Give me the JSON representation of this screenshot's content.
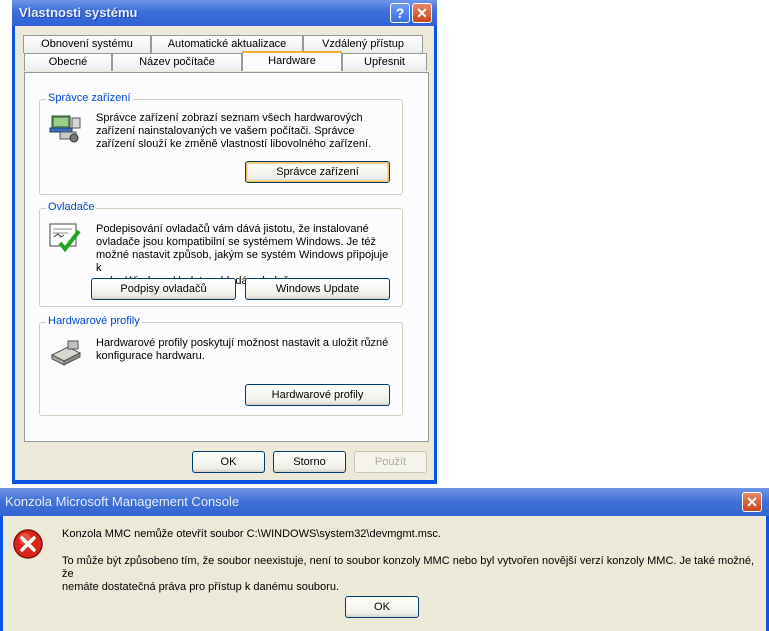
{
  "system_properties": {
    "title": "Vlastnosti systému",
    "help_glyph": "?",
    "close_glyph": "✕",
    "tabs_row_back": [
      {
        "label": "Obnovení systému"
      },
      {
        "label": "Automatické aktualizace"
      },
      {
        "label": "Vzdálený přístup"
      }
    ],
    "tabs_row_front": [
      {
        "label": "Obecné"
      },
      {
        "label": "Název počítače"
      },
      {
        "label": "Hardware",
        "active": true
      },
      {
        "label": "Upřesnit"
      }
    ],
    "device_manager": {
      "legend": "Správce zařízení",
      "text_lines": [
        "Správce zařízení zobrazí seznam všech hardwarových",
        "zařízení nainstalovaných ve vašem počítači. Správce",
        "zařízení slouží ke změně vlastností libovolného zařízení."
      ],
      "button": "Správce zařízení",
      "icon": "device-manager-icon"
    },
    "drivers": {
      "legend": "Ovladače",
      "text_lines": [
        "Podepisování ovladačů vám dává jistotu, že instalované",
        "ovladače jsou kompatibilní se systémem Windows. Je též",
        "možné nastavit způsob, jakým se systém Windows připojuje k",
        "webu Windows Update a hledá ovladače."
      ],
      "button_signing": "Podpisy ovladačů",
      "button_update": "Windows Update",
      "icon": "driver-signing-icon"
    },
    "hardware_profiles": {
      "legend": "Hardwarové profily",
      "text_lines": [
        "Hardwarové profily poskytují možnost nastavit a uložit různé",
        "konfigurace hardwaru."
      ],
      "button": "Hardwarové profily",
      "icon": "hardware-profiles-icon"
    },
    "footer": {
      "ok": "OK",
      "cancel": "Storno",
      "apply": "Použít"
    }
  },
  "mmc_error": {
    "title": "Konzola Microsoft Management Console",
    "close_glyph": "✕",
    "icon": "error-icon",
    "line1": "Konzola MMC nemůže otevřít soubor C:\\WINDOWS\\system32\\devmgmt.msc.",
    "line2a": "To může být způsobeno tím, že soubor neexistuje, není to soubor konzoly MMC nebo byl vytvořen novější verzí konzoly MMC. Je také možné, že",
    "line2b": "nemáte dostatečná práva pro přístup k danému souboru.",
    "ok": "OK"
  },
  "colors": {
    "title_bar": "#2f63d6",
    "dialog_bg": "#ece9d8",
    "group_legend": "#0046d5",
    "active_tab_accent": "#f7b236",
    "close_button": "#c8441c"
  }
}
